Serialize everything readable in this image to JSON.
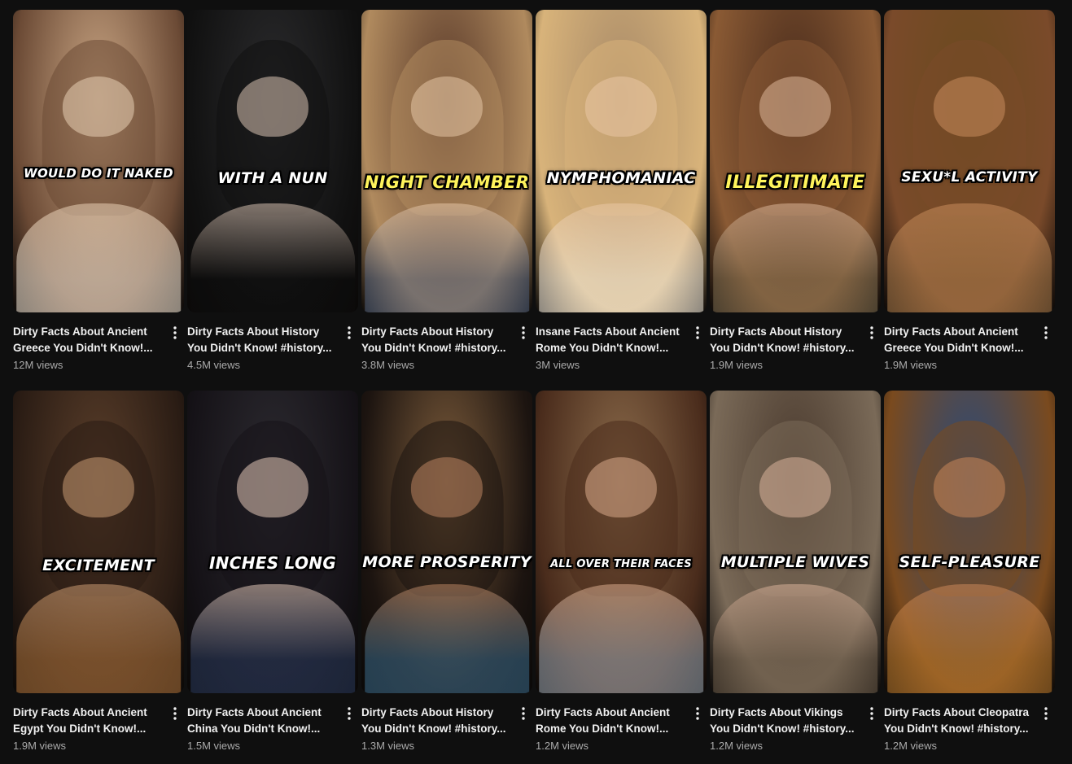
{
  "shorts": [
    {
      "caption": "WOULD DO IT NAKED",
      "title": "Dirty Facts About Ancient Greece You Didn't Know!...",
      "views": "12M views",
      "caption_color": "white",
      "palette": [
        "#c9a583",
        "#6b4a35",
        "#e8cfb4",
        "#f1e6d6"
      ]
    },
    {
      "caption": "WITH A NUN",
      "title": "Dirty Facts About History You Didn't Know! #history...",
      "views": "4.5M views",
      "caption_color": "white",
      "palette": [
        "#2b2b2d",
        "#111111",
        "#d9c3b3",
        "#0c0c0c"
      ]
    },
    {
      "caption": "NIGHT CHAMBER",
      "title": "Dirty Facts About History You Didn't Know! #history...",
      "views": "3.8M views",
      "caption_color": "yellow",
      "palette": [
        "#5a3a2a",
        "#b08a5e",
        "#e6c6a6",
        "#4c5d7a"
      ]
    },
    {
      "caption": "NYMPHOMANIAC",
      "title": "Insane Facts About Ancient Rome You Didn't Know!...",
      "views": "3M views",
      "caption_color": "white",
      "palette": [
        "#a88a68",
        "#d8b37a",
        "#e9c7a4",
        "#ece6da"
      ]
    },
    {
      "caption": "ILLEGITIMATE",
      "title": "Dirty Facts About History You Didn't Know! #history...",
      "views": "1.9M views",
      "caption_color": "yellow",
      "palette": [
        "#4a2c1c",
        "#8a5a34",
        "#dcb699",
        "#7a6a4e"
      ]
    },
    {
      "caption": "SEXU*L ACTIVITY",
      "title": "Dirty Facts About Ancient Greece You Didn't Know!...",
      "views": "1.9M views",
      "caption_color": "white",
      "palette": [
        "#6a4a1e",
        "#7a4a2a",
        "#c98d5c",
        "#a87a4a"
      ]
    },
    {
      "caption": "EXCITEMENT",
      "title": "Dirty Facts About Ancient Egypt You Didn't Know!...",
      "views": "1.9M views",
      "caption_color": "white",
      "palette": [
        "#5a3e2a",
        "#2a1c14",
        "#c99a72",
        "#b0743c"
      ]
    },
    {
      "caption": "INCHES LONG",
      "title": "Dirty Facts About Ancient China You Didn't Know!...",
      "views": "1.5M views",
      "caption_color": "white",
      "palette": [
        "#2c2a30",
        "#151217",
        "#e3c8b8",
        "#2a3a5c"
      ]
    },
    {
      "caption": "MORE PROSPERITY",
      "title": "Dirty Facts About History You Didn't Know! #history...",
      "views": "1.3M views",
      "caption_color": "white",
      "palette": [
        "#7a5a3a",
        "#1c1410",
        "#b98461",
        "#3a6a8a"
      ]
    },
    {
      "caption": "ALL OVER THEIR FACES",
      "title": "Dirty Facts About Ancient Rome You Didn't Know!...",
      "views": "1.2M views",
      "caption_color": "white",
      "palette": [
        "#8a6a4a",
        "#4a2c1c",
        "#d8a98a",
        "#9aa6b2"
      ]
    },
    {
      "caption": "MULTIPLE WIVES",
      "title": "Dirty Facts About Vikings You Didn't Know! #history...",
      "views": "1.2M views",
      "caption_color": "white",
      "palette": [
        "#4a3a2e",
        "#7a6a58",
        "#d9b29a",
        "#6a5a48"
      ]
    },
    {
      "caption": "SELF-PLEASURE",
      "title": "Dirty Facts About Cleopatra You Didn't Know! #history...",
      "views": "1.2M views",
      "caption_color": "white",
      "palette": [
        "#2a4a7a",
        "#7a4a1e",
        "#c9875a",
        "#b8782c"
      ]
    }
  ],
  "colors": {
    "background": "#0f0f0f",
    "title": "#f1f1f1",
    "views": "#aaaaaa",
    "caption_yellow": "#fff45c"
  },
  "icons": {
    "more": "more-vert-icon"
  }
}
